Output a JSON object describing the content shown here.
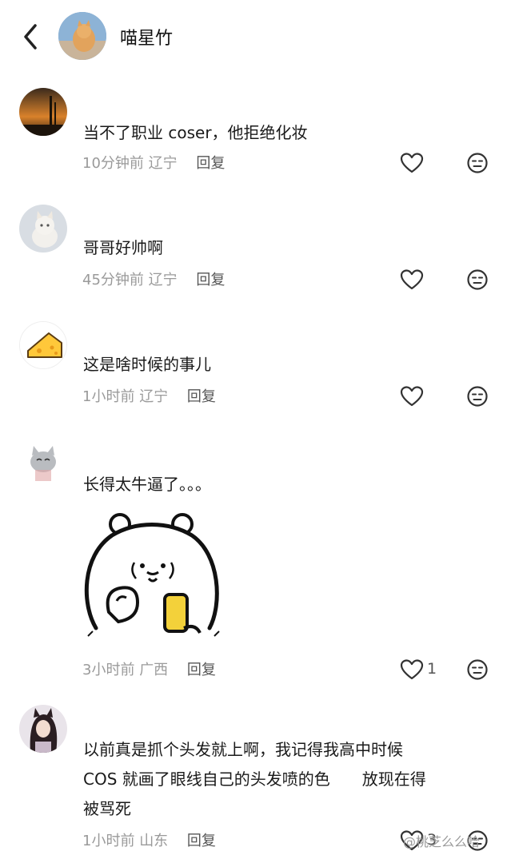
{
  "header": {
    "title": "喵星竹",
    "back_icon": "chevron-left-icon"
  },
  "comments": [
    {
      "text": "当不了职业 coser，他拒绝化妆",
      "time": "10分钟前",
      "location": "辽宁",
      "reply": "回复",
      "likes": ""
    },
    {
      "text": "哥哥好帅啊",
      "time": "45分钟前",
      "location": "辽宁",
      "reply": "回复",
      "likes": ""
    },
    {
      "text": "这是啥时候的事儿",
      "time": "1小时前",
      "location": "辽宁",
      "reply": "回复",
      "likes": ""
    },
    {
      "text": "长得太牛逼了。。。",
      "time": "3小时前",
      "location": "广西",
      "reply": "回复",
      "likes": "1"
    },
    {
      "text_lines": [
        "以前真是抓个头发就上啊，我记得我高中时候",
        "COS 就画了眼线自己的头发喷的色　　放现在得",
        "被骂死"
      ],
      "time": "1小时前",
      "location": "山东",
      "reply": "回复",
      "likes": "3"
    }
  ],
  "watermark": "@桃芝么么哈",
  "colors": {
    "text": "#1a1a1a",
    "meta": "#9a9a9a",
    "icon": "#333333"
  }
}
